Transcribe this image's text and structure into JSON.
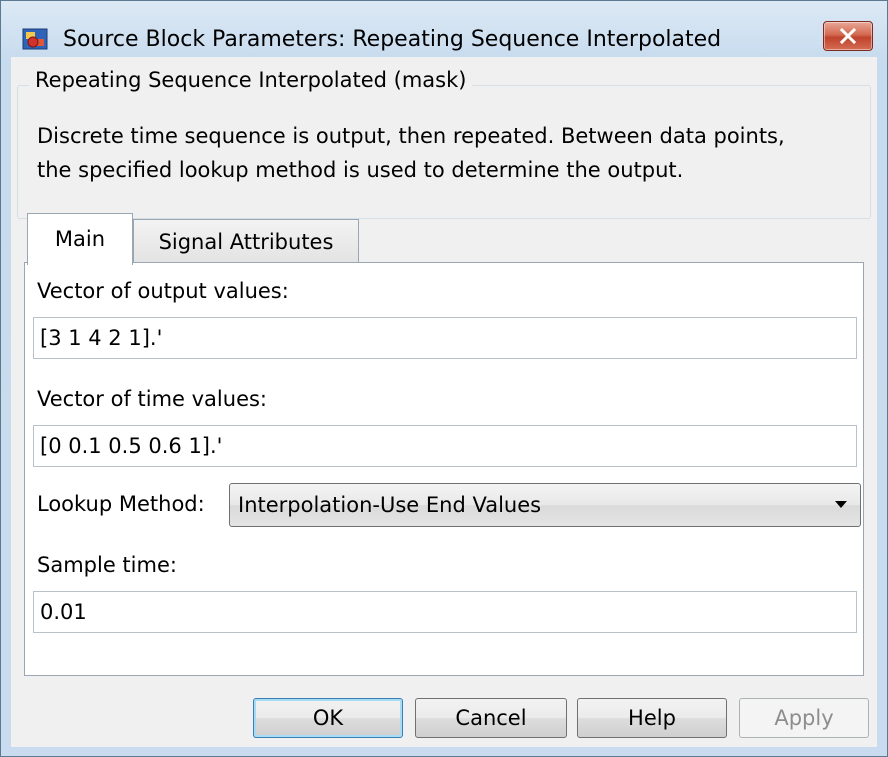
{
  "window": {
    "title": "Source Block Parameters: Repeating Sequence Interpolated",
    "app_icon": "simulink-block-icon",
    "close_icon": "close-icon"
  },
  "mask": {
    "group_title": "Repeating Sequence Interpolated (mask)",
    "description_lines": [
      "Discrete time sequence is output, then repeated.  Between data points,",
      "the specified lookup method is used to determine the output."
    ]
  },
  "tabs": [
    {
      "label": "Main",
      "selected": true
    },
    {
      "label": "Signal Attributes",
      "selected": false
    }
  ],
  "params": {
    "output_values": {
      "label": "Vector of output values:",
      "value": "[3 1 4 2 1].'"
    },
    "time_values": {
      "label": "Vector of time values:",
      "value": "[0 0.1 0.5 0.6 1].'"
    },
    "lookup_method": {
      "label": "Lookup Method:",
      "value": "Interpolation-Use End Values",
      "icon": "chevron-down-icon"
    },
    "sample_time": {
      "label": "Sample time:",
      "value": "0.01"
    }
  },
  "buttons": {
    "ok": "OK",
    "cancel": "Cancel",
    "help": "Help",
    "apply": "Apply"
  },
  "colors": {
    "titlebar": "#cfe0f1",
    "close_button": "#c74c35",
    "ok_focus": "#3c7fb1",
    "disabled_text": "#8d8d8d"
  }
}
